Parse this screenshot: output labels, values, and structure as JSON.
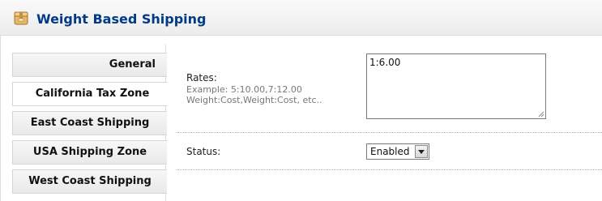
{
  "header": {
    "icon": "box-icon",
    "title": "Weight Based Shipping"
  },
  "tabs": [
    {
      "label": "General",
      "active": false
    },
    {
      "label": "California Tax Zone",
      "active": true
    },
    {
      "label": "East Coast Shipping",
      "active": false
    },
    {
      "label": "USA Shipping Zone",
      "active": false
    },
    {
      "label": "West Coast Shipping",
      "active": false
    }
  ],
  "form": {
    "rates": {
      "label": "Rates:",
      "help_line1": "Example: 5:10.00,7:12.00",
      "help_line2": "Weight:Cost,Weight:Cost, etc..",
      "value": "1:6.00"
    },
    "status": {
      "label": "Status:",
      "selected": "Enabled"
    }
  },
  "colors": {
    "title": "#003a88",
    "help_text": "#777777"
  }
}
